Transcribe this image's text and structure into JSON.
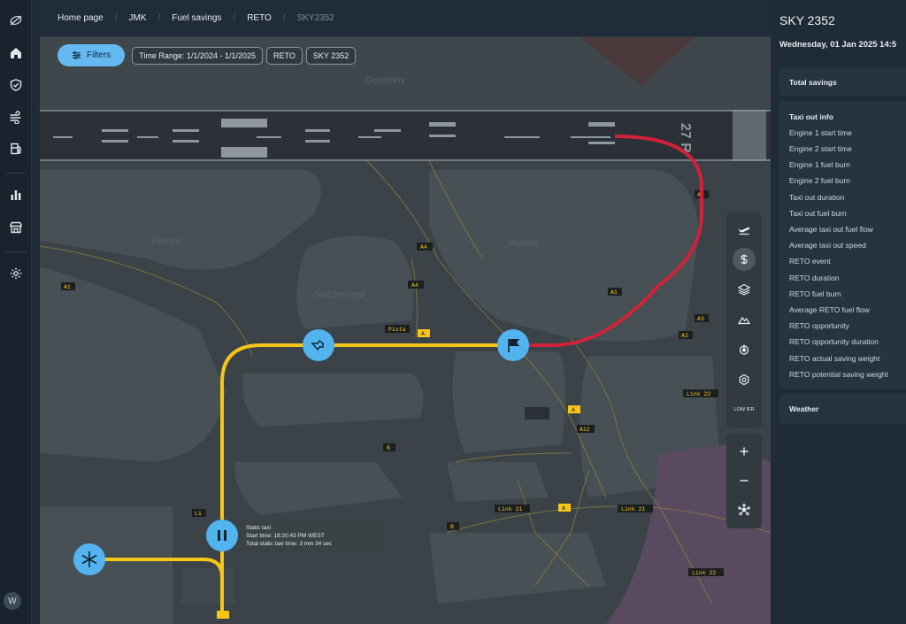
{
  "breadcrumb": [
    "Home page",
    "JMK",
    "Fuel savings",
    "RETO",
    "SKY2352"
  ],
  "filters": {
    "button_label": "Filters",
    "chips": [
      "Time Range: 1/1/2024 - 1/1/2025",
      "RETO",
      "SKY 2352"
    ]
  },
  "user": {
    "initial": "W"
  },
  "sidebar_icons": [
    "logo-icon",
    "home-icon",
    "shield-icon",
    "wind-icon",
    "fuel-station-icon",
    "bar-chart-icon",
    "store-icon",
    "settings-icon"
  ],
  "map": {
    "labels": {
      "germany": "Germany",
      "france": "France",
      "switzerland": "Switzerland",
      "austria": "Austria",
      "runway": "27 R"
    },
    "signs": [
      "A4",
      "A4",
      "A1",
      "A1",
      "A2",
      "A3",
      "A3",
      "A",
      "A",
      "A",
      "A12",
      "B",
      "B",
      "L1",
      "L",
      "Link 21",
      "Link 21",
      "Link 22",
      "Link 22",
      "Pista"
    ],
    "tooltip": {
      "title": "Static taxi",
      "start": "Start time: 19:20:43 PM WEST",
      "total": "Total static taxi time: 3 min 34 sec"
    },
    "route_colors": {
      "taxi": "#f5c518",
      "reto": "#d0223a",
      "marker": "#52b3ef"
    },
    "tools": [
      "plane-takeoff-icon",
      "dollar-icon",
      "layers-icon",
      "terrain-icon",
      "power-icon",
      "hexagon-gear-icon"
    ],
    "low_ifr_label": "LOW IFR",
    "zoom_tools": [
      "zoom-in-icon",
      "zoom-out-icon",
      "network-icon"
    ]
  },
  "panel": {
    "title": "SKY 2352",
    "date": "Wednesday, 01 Jan 2025 14:5",
    "total_savings": "Total savings",
    "taxi_out_info": "Taxi out info",
    "taxi_items": [
      "Engine 1 start time",
      "Engine 2 start time",
      "Engine 1 fuel burn",
      "Engine 2 fuel burn",
      "Taxi out duration",
      "Taxi out fuel burn",
      "Average taxi out fuel flow",
      "Average taxi out speed",
      "RETO event",
      "RETO duration",
      "RETO fuel burn",
      "Average RETO fuel flow",
      "RETO opportunity",
      "RETO opportunity duration",
      "RETO actual saving weight",
      "RETO potential saving weight"
    ],
    "weather": "Weather"
  }
}
